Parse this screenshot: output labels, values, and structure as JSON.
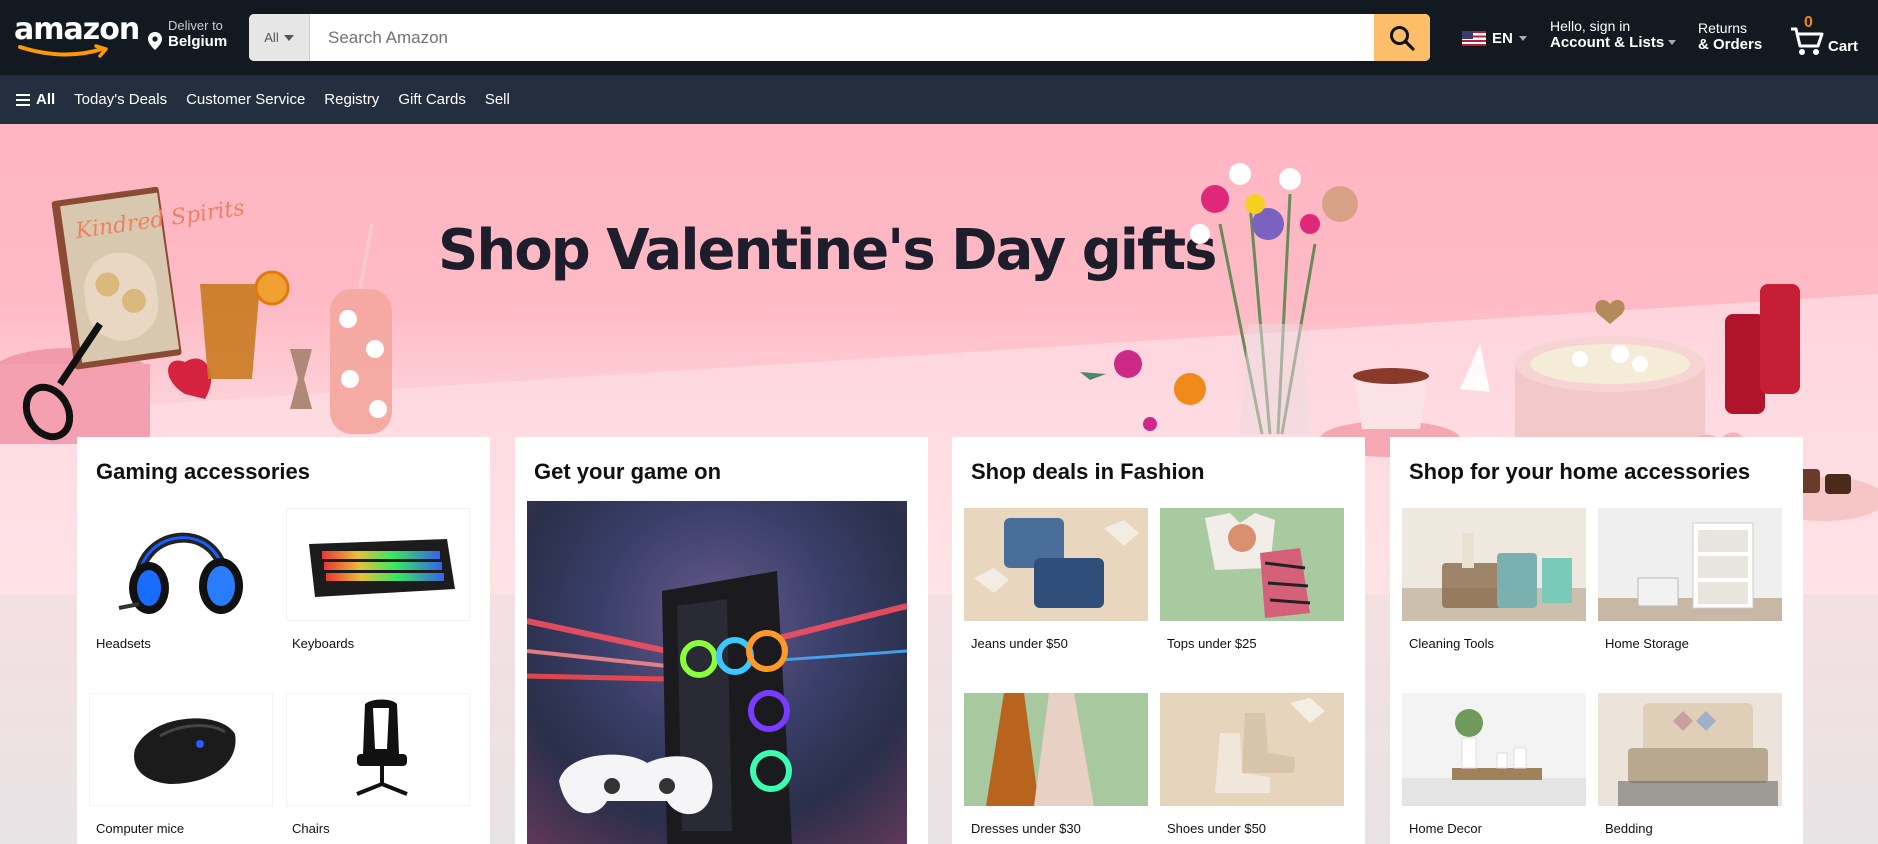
{
  "header": {
    "logo_text": "amazon",
    "deliver_to_line1": "Deliver to",
    "deliver_to_line2": "Belgium",
    "search": {
      "category": "All",
      "placeholder": "Search Amazon",
      "value": ""
    },
    "language": "EN",
    "account_line1": "Hello, sign in",
    "account_line2": "Account & Lists",
    "returns_line1": "Returns",
    "returns_line2": "& Orders",
    "cart_count": "0",
    "cart_label": "Cart",
    "colors": {
      "nav_bg": "#131921",
      "subnav_bg": "#232f3e",
      "search_button": "#febd69",
      "cart_count": "#f08804"
    }
  },
  "subnav": {
    "all_label": "All",
    "links": [
      "Today's Deals",
      "Customer Service",
      "Registry",
      "Gift Cards",
      "Sell"
    ]
  },
  "hero": {
    "title": "Shop Valentine's Day gifts",
    "book_title": "Kindred Spirits"
  },
  "cards": [
    {
      "title": "Gaming accessories",
      "tiles": [
        {
          "label": "Headsets",
          "icon": "headset-icon"
        },
        {
          "label": "Keyboards",
          "icon": "keyboard-icon"
        },
        {
          "label": "Computer mice",
          "icon": "mouse-icon"
        },
        {
          "label": "Chairs",
          "icon": "chair-icon"
        }
      ]
    },
    {
      "title": "Get your game on",
      "image": "gaming-pc-image"
    },
    {
      "title": "Shop deals in Fashion",
      "tiles": [
        {
          "label": "Jeans under $50"
        },
        {
          "label": "Tops under $25"
        },
        {
          "label": "Dresses under $30"
        },
        {
          "label": "Shoes under $50"
        }
      ]
    },
    {
      "title": "Shop for your home accessories",
      "tiles": [
        {
          "label": "Cleaning Tools"
        },
        {
          "label": "Home Storage"
        },
        {
          "label": "Home Decor"
        },
        {
          "label": "Bedding"
        }
      ]
    }
  ]
}
